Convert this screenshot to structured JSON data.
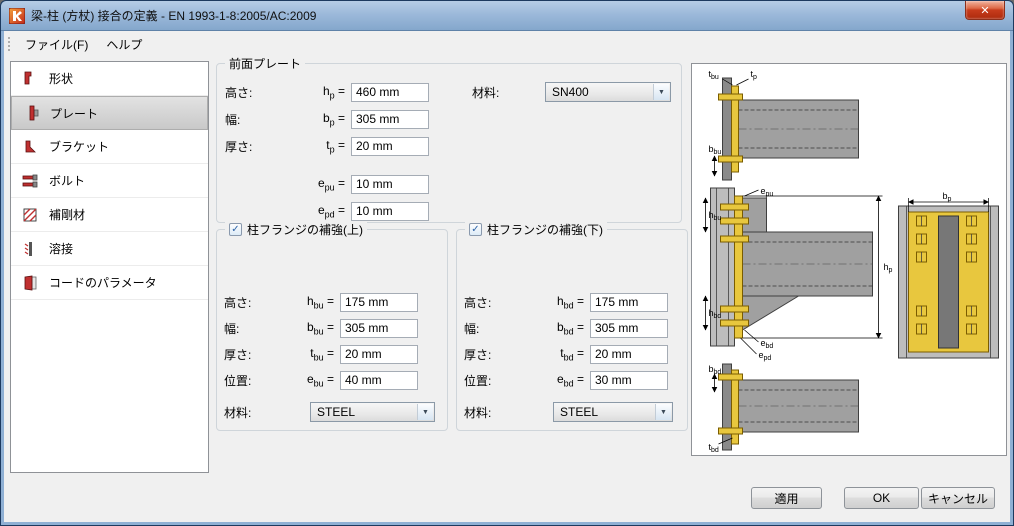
{
  "ui": {
    "equals": "=",
    "check": "✓",
    "close_glyph": "✕",
    "dropdown_arrow": "▼"
  },
  "window": {
    "title": "梁-柱 (方杖) 接合の定義 - EN 1993-1-8:2005/AC:2009"
  },
  "menu": {
    "file": "ファイル(F)",
    "help": "ヘルプ"
  },
  "sidebar": {
    "items": [
      "形状",
      "プレート",
      "ブラケット",
      "ボルト",
      "補剛材",
      "溶接",
      "コードのパラメータ"
    ]
  },
  "front_plate": {
    "legend": "前面プレート",
    "material_label": "材料:",
    "material_value": "SN400",
    "fields": [
      {
        "label": "高さ:",
        "base": "h",
        "sub": "p",
        "value": "460 mm"
      },
      {
        "label": "幅:",
        "base": "b",
        "sub": "p",
        "value": "305 mm"
      },
      {
        "label": "厚さ:",
        "base": "t",
        "sub": "p",
        "value": "20 mm"
      },
      {
        "label": "",
        "base": "e",
        "sub": "pu",
        "value": "10 mm"
      },
      {
        "label": "",
        "base": "e",
        "sub": "pd",
        "value": "10 mm"
      }
    ]
  },
  "upper": {
    "legend": "柱フランジの補強(上)",
    "checked": true,
    "material_label": "材料:",
    "material_value": "STEEL",
    "fields": [
      {
        "label": "高さ:",
        "base": "h",
        "sub": "bu",
        "value": "175 mm"
      },
      {
        "label": "幅:",
        "base": "b",
        "sub": "bu",
        "value": "305 mm"
      },
      {
        "label": "厚さ:",
        "base": "t",
        "sub": "bu",
        "value": "20 mm"
      },
      {
        "label": "位置:",
        "base": "e",
        "sub": "bu",
        "value": "40 mm"
      }
    ]
  },
  "lower": {
    "legend": "柱フランジの補強(下)",
    "checked": true,
    "material_label": "材料:",
    "material_value": "STEEL",
    "fields": [
      {
        "label": "高さ:",
        "base": "h",
        "sub": "bd",
        "value": "175 mm"
      },
      {
        "label": "幅:",
        "base": "b",
        "sub": "bd",
        "value": "305 mm"
      },
      {
        "label": "厚さ:",
        "base": "t",
        "sub": "bd",
        "value": "20 mm"
      },
      {
        "label": "位置:",
        "base": "e",
        "sub": "bd",
        "value": "30 mm"
      }
    ]
  },
  "diagram": {
    "labels": {
      "tbu": {
        "base": "t",
        "sub": "bu"
      },
      "tp": {
        "base": "t",
        "sub": "p"
      },
      "bbu": {
        "base": "b",
        "sub": "bu"
      },
      "bp": {
        "base": "b",
        "sub": "p"
      },
      "epu": {
        "base": "e",
        "sub": "pu"
      },
      "hbu": {
        "base": "h",
        "sub": "bu"
      },
      "hbd": {
        "base": "h",
        "sub": "bd"
      },
      "hp": {
        "base": "h",
        "sub": "p"
      },
      "ebd": {
        "base": "e",
        "sub": "bd"
      },
      "epd": {
        "base": "e",
        "sub": "pd"
      },
      "bbd": {
        "base": "b",
        "sub": "bd"
      },
      "tbd": {
        "base": "t",
        "sub": "bd"
      }
    }
  },
  "buttons": {
    "apply": "適用",
    "ok": "OK",
    "cancel": "キャンセル"
  }
}
